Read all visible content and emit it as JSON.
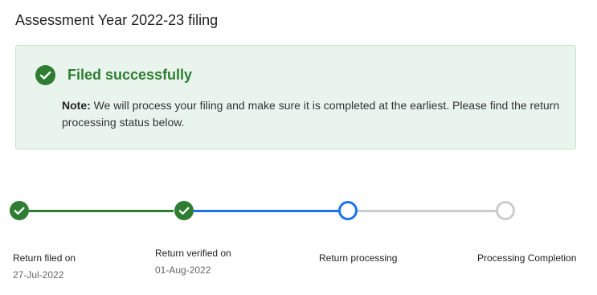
{
  "page": {
    "title": "Assessment Year 2022-23 filing"
  },
  "notice": {
    "heading": "Filed successfully",
    "note_label": "Note:",
    "note_text": " We will process your filing and make sure it is completed at the earliest. Please find the return processing status below.",
    "icon": "check-circle-icon",
    "accent_color": "#2e7d32",
    "background_color": "#e9f5ec"
  },
  "progress": {
    "current_step": 3,
    "total_steps": 4,
    "colors": {
      "done": "#2e7d32",
      "active": "#1a73e8",
      "pending": "#cccccc"
    },
    "steps": [
      {
        "label": "Return filed on",
        "date": "27-Jul-2022",
        "status": "done"
      },
      {
        "label": "Return verified on",
        "date": "01-Aug-2022",
        "status": "done"
      },
      {
        "label": "Return processing",
        "date": "",
        "status": "active"
      },
      {
        "label": "Processing Completion",
        "date": "",
        "status": "pending"
      }
    ]
  }
}
